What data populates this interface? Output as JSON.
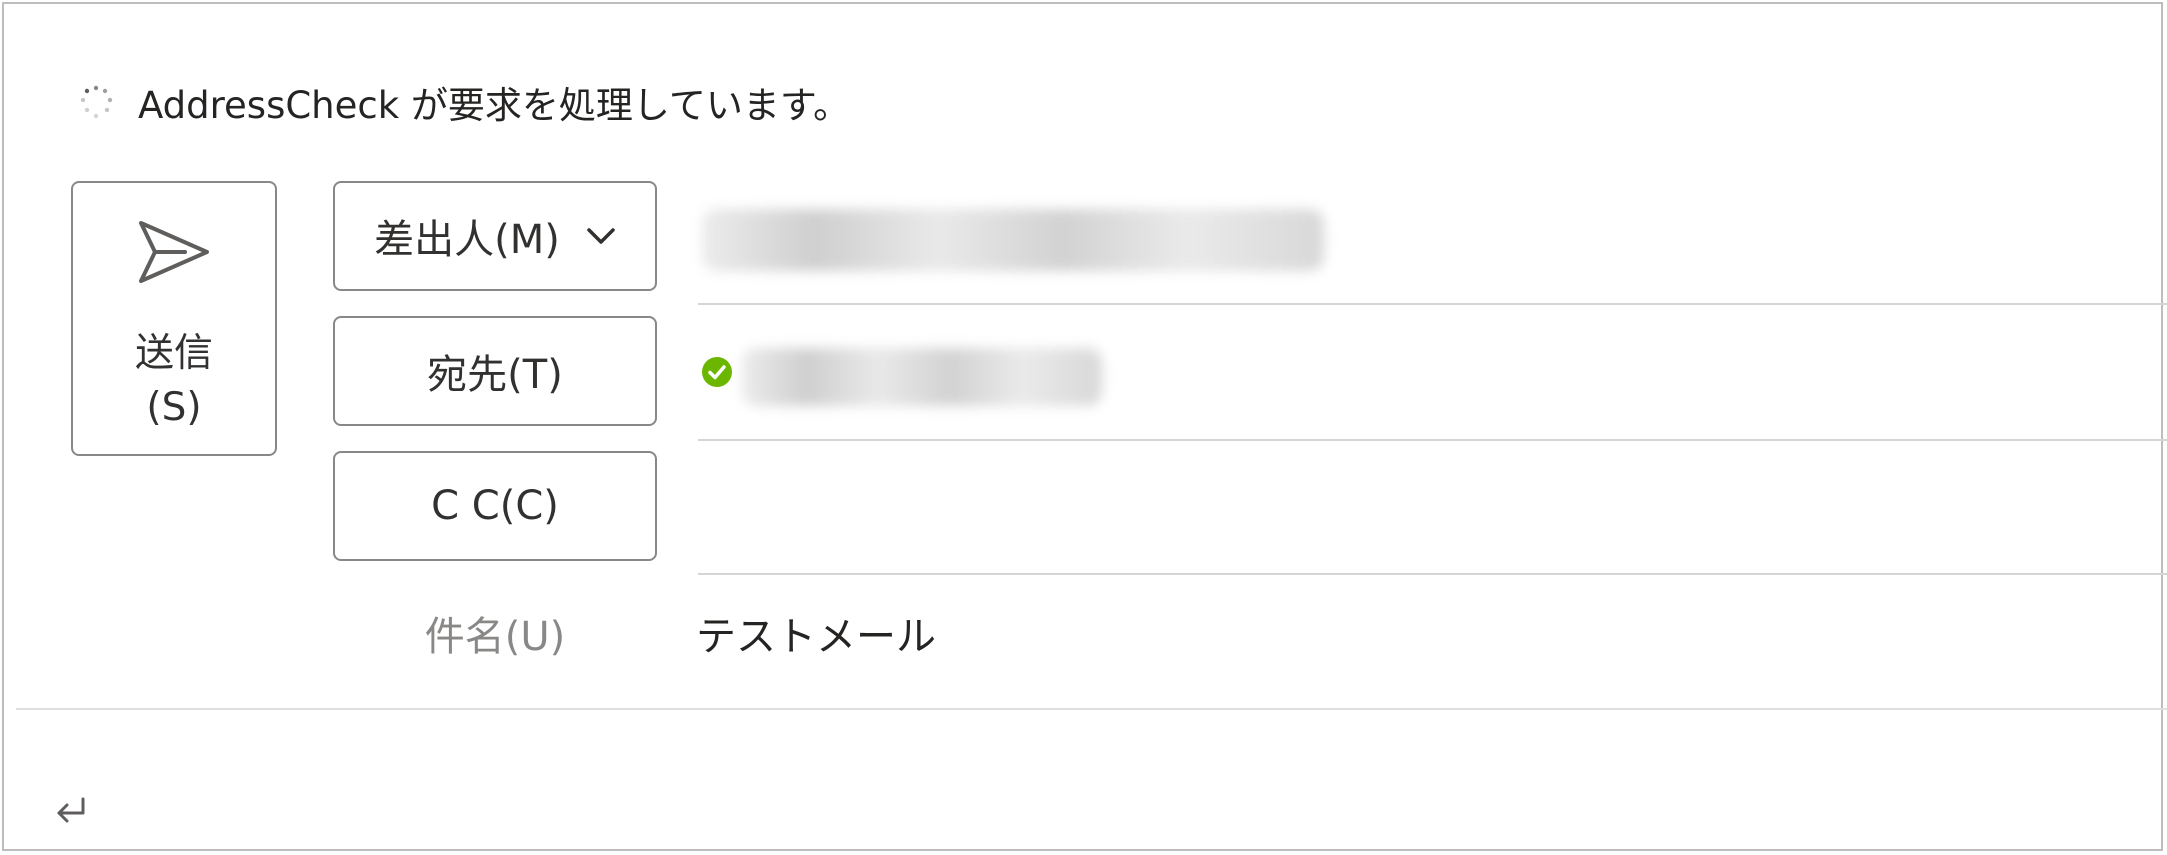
{
  "status": {
    "text": "AddressCheck が要求を処理しています。",
    "icon": "loading-spinner-icon"
  },
  "compose": {
    "send_button": {
      "label": "送信\n(S)",
      "icon": "send-icon"
    },
    "from_button": {
      "label": "差出人(M)",
      "icon": "chevron-down-icon"
    },
    "to_button": {
      "label": "宛先(T)"
    },
    "cc_button": {
      "label": "C C(C)"
    },
    "subject": {
      "label": "件名(U)",
      "value": "テストメール"
    },
    "to_recipient": {
      "icon": "check-circle-icon",
      "status_color": "#6bb700"
    },
    "body": {
      "icon": "enter-return-icon"
    }
  },
  "colors": {
    "text": "#252423",
    "muted_label": "#8a8886",
    "border": "#8a8886",
    "line": "#d5d5d5",
    "success": "#6bb700"
  }
}
